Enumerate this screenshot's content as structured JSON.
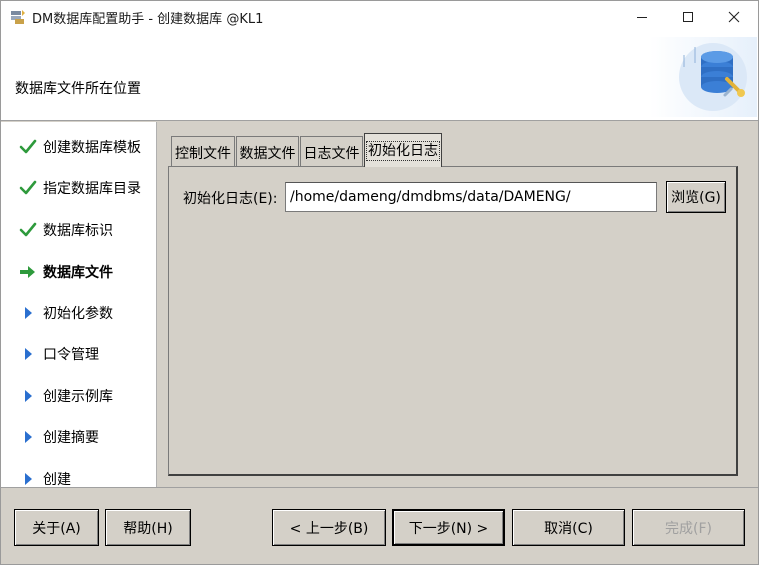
{
  "window": {
    "title": "DM数据库配置助手 - 创建数据库 @KL1"
  },
  "header": {
    "title": "数据库文件所在位置"
  },
  "steps": [
    {
      "label": "创建数据库模板",
      "state": "done"
    },
    {
      "label": "指定数据库目录",
      "state": "done"
    },
    {
      "label": "数据库标识",
      "state": "done"
    },
    {
      "label": "数据库文件",
      "state": "current"
    },
    {
      "label": "初始化参数",
      "state": "pending"
    },
    {
      "label": "口令管理",
      "state": "pending"
    },
    {
      "label": "创建示例库",
      "state": "pending"
    },
    {
      "label": "创建摘要",
      "state": "pending"
    },
    {
      "label": "创建",
      "state": "pending"
    }
  ],
  "tabs": [
    {
      "label": "控制文件"
    },
    {
      "label": "数据文件"
    },
    {
      "label": "日志文件"
    },
    {
      "label": "初始化日志",
      "active": true
    }
  ],
  "init_log": {
    "label": "初始化日志(E):",
    "path": "/home/dameng/dmdbms/data/DAMENG/",
    "browse_label": "浏览(G)"
  },
  "footer": {
    "about": "关于(A)",
    "help": "帮助(H)",
    "prev": "< 上一步(B)",
    "next": "下一步(N) >",
    "cancel": "取消(C)",
    "finish": "完成(F)"
  },
  "colors": {
    "done_check": "#2e9a3c",
    "current_arrow": "#2e9a3c",
    "pending_triangle": "#2a6fcf"
  },
  "icons": {
    "done": "check-icon",
    "current": "arrow-right-icon",
    "pending": "triangle-right-icon"
  }
}
